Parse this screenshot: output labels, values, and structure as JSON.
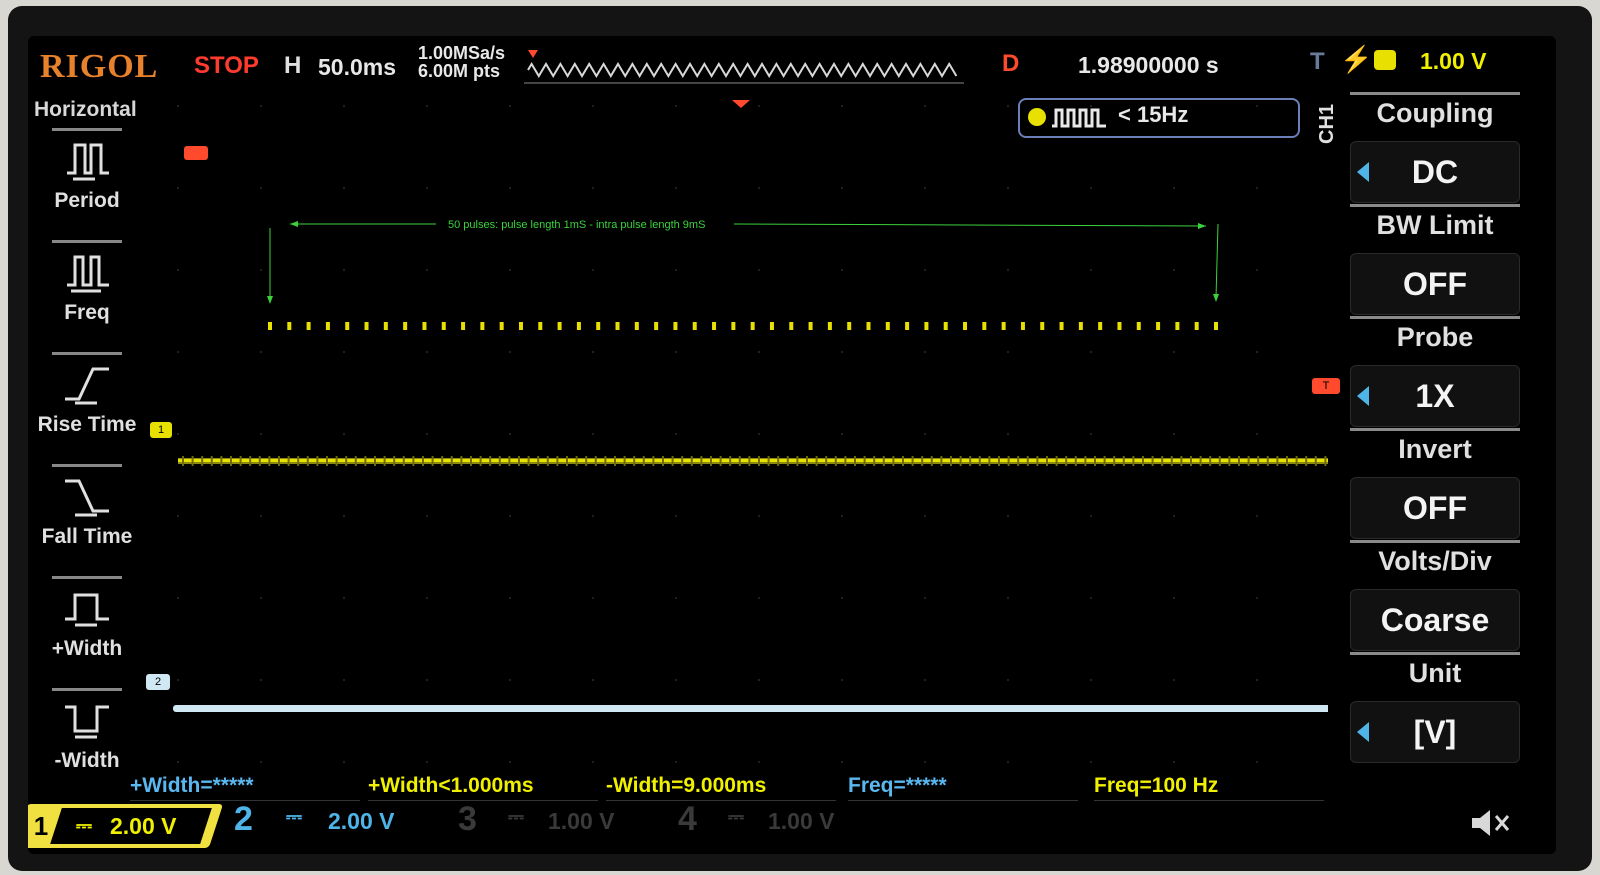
{
  "header": {
    "brand": "RIGOL",
    "run_state": "STOP",
    "h_label": "H",
    "timebase": "50.0ms",
    "sample_rate": "1.00MSa/s",
    "memory_depth": "6.00M pts",
    "delay_label": "D",
    "delay_value": "1.98900000 s",
    "trigger_label": "T",
    "trigger_level": "1.00 V",
    "trigger_filter": "< 15Hz"
  },
  "annotation": {
    "text": "50 pulses:  pulse length 1mS - intra pulse length 9mS"
  },
  "left_menu": {
    "title": "Horizontal",
    "items": [
      {
        "label": "Period",
        "icon": "period-icon"
      },
      {
        "label": "Freq",
        "icon": "freq-icon"
      },
      {
        "label": "Rise Time",
        "icon": "rise-time-icon"
      },
      {
        "label": "Fall Time",
        "icon": "fall-time-icon"
      },
      {
        "label": "+Width",
        "icon": "positive-width-icon"
      },
      {
        "label": "-Width",
        "icon": "negative-width-icon"
      }
    ]
  },
  "right_menu": {
    "channel": "CH1",
    "items": [
      {
        "title": "Coupling",
        "value": "DC"
      },
      {
        "title": "BW Limit",
        "value": "OFF"
      },
      {
        "title": "Probe",
        "value": "1X"
      },
      {
        "title": "Invert",
        "value": "OFF"
      },
      {
        "title": "Volts/Div",
        "value": "Coarse"
      },
      {
        "title": "Unit",
        "value": "[V]"
      }
    ]
  },
  "measurements": [
    {
      "text": "+Width=*****",
      "color": "#5ab8f0"
    },
    {
      "text": "+Width<1.000ms",
      "color": "#f0f000"
    },
    {
      "text": "-Width=9.000ms",
      "color": "#f0f000"
    },
    {
      "text": "Freq=*****",
      "color": "#5ab8f0"
    },
    {
      "text": "Freq=100 Hz",
      "color": "#f0f000"
    }
  ],
  "channels": {
    "ch1_num": "1",
    "ch1_coupling": "⎓",
    "ch1_scale": "2.00 V",
    "ch2_num": "2",
    "ch2_coupling": "⎓",
    "ch2_scale": "2.00 V",
    "ch3_num": "3",
    "ch3_coupling": "⎓",
    "ch3_scale": "1.00 V",
    "ch4_num": "4",
    "ch4_coupling": "⎓",
    "ch4_scale": "1.00 V"
  },
  "markers": {
    "trigger_position": "T",
    "ch1_marker": "1",
    "ch2_marker": "2"
  },
  "colors": {
    "ch1": "#f0f000",
    "ch2": "#5ab8f0",
    "annotation": "#3cd23c",
    "trigger": "#ff4a2e"
  },
  "pulses": {
    "count": 50
  }
}
